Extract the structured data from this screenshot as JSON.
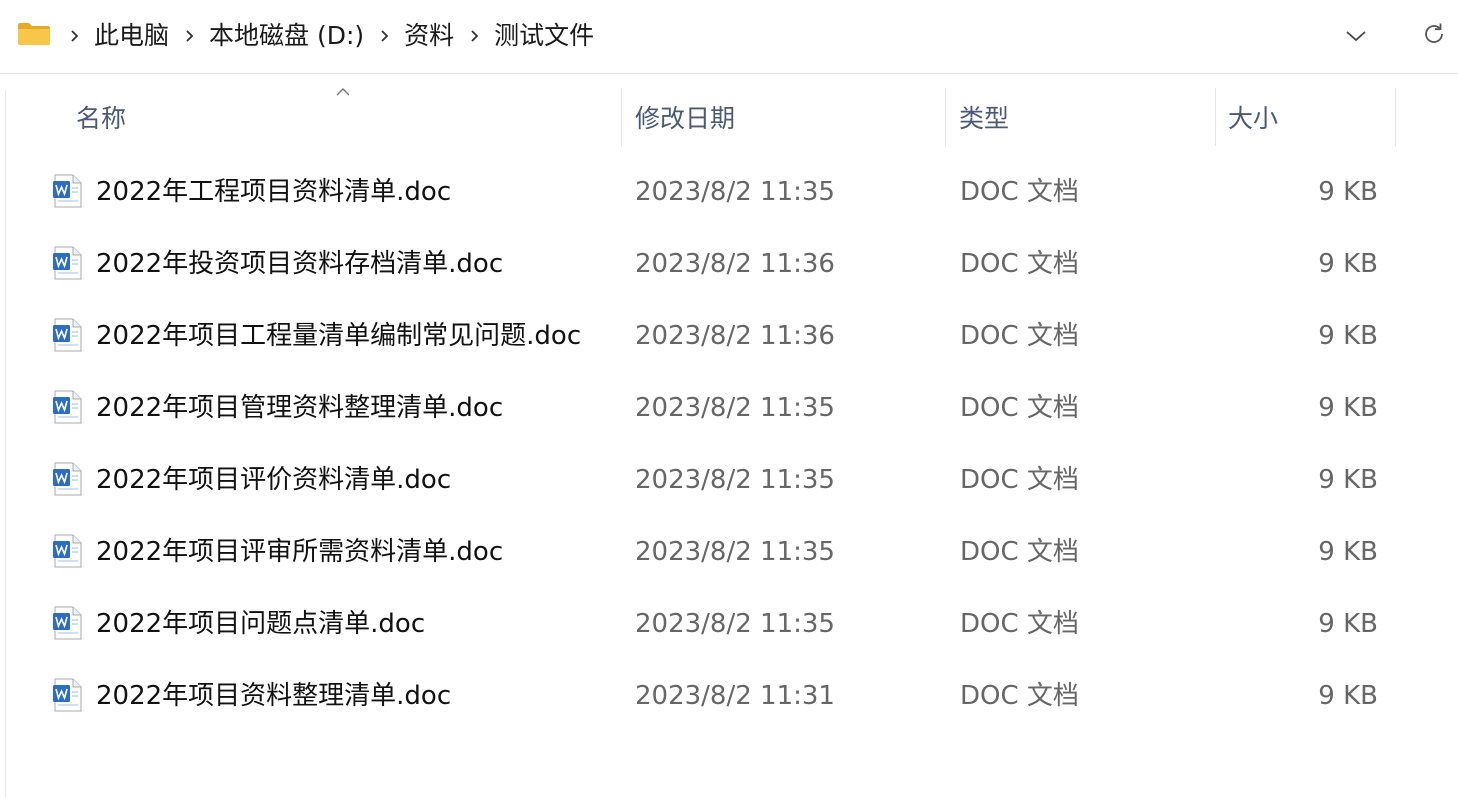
{
  "address_bar": {
    "breadcrumbs": [
      "此电脑",
      "本地磁盘 (D:)",
      "资料",
      "测试文件"
    ]
  },
  "columns": {
    "name": "名称",
    "modified": "修改日期",
    "type": "类型",
    "size": "大小"
  },
  "files": [
    {
      "name": "2022年工程项目资料清单.doc",
      "modified": "2023/8/2 11:35",
      "type": "DOC 文档",
      "size": "9 KB"
    },
    {
      "name": "2022年投资项目资料存档清单.doc",
      "modified": "2023/8/2 11:36",
      "type": "DOC 文档",
      "size": "9 KB"
    },
    {
      "name": "2022年项目工程量清单编制常见问题.doc",
      "modified": "2023/8/2 11:36",
      "type": "DOC 文档",
      "size": "9 KB"
    },
    {
      "name": "2022年项目管理资料整理清单.doc",
      "modified": "2023/8/2 11:35",
      "type": "DOC 文档",
      "size": "9 KB"
    },
    {
      "name": "2022年项目评价资料清单.doc",
      "modified": "2023/8/2 11:35",
      "type": "DOC 文档",
      "size": "9 KB"
    },
    {
      "name": "2022年项目评审所需资料清单.doc",
      "modified": "2023/8/2 11:35",
      "type": "DOC 文档",
      "size": "9 KB"
    },
    {
      "name": "2022年项目问题点清单.doc",
      "modified": "2023/8/2 11:35",
      "type": "DOC 文档",
      "size": "9 KB"
    },
    {
      "name": "2022年项目资料整理清单.doc",
      "modified": "2023/8/2 11:31",
      "type": "DOC 文档",
      "size": "9 KB"
    }
  ],
  "icons": {
    "folder": "folder-icon",
    "file": "word-doc-icon",
    "separator": "chevron-right-icon",
    "dropdown": "chevron-down-icon",
    "refresh": "refresh-icon",
    "sort": "sort-ascending-icon"
  },
  "colors": {
    "folder_yellow": "#f8c74a",
    "word_blue": "#2b6cc4",
    "header_text": "#4a5a75",
    "secondary_text": "#666666"
  }
}
